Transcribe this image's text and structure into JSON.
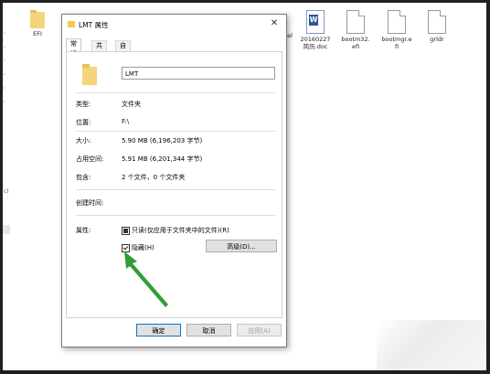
{
  "desktop": {
    "left_strip": [
      "’",
      "’",
      "’",
      "’",
      "’",
      "’",
      "c)"
    ],
    "icons": [
      {
        "label": "EFI",
        "type": "folder"
      },
      {
        "label": "bel",
        "type": "partial"
      },
      {
        "label": "20160227\n简历.doc",
        "type": "word"
      },
      {
        "label": "bootm32.\nefi",
        "type": "file"
      },
      {
        "label": "bootmgr.e\nfi",
        "type": "file"
      },
      {
        "label": "grldr",
        "type": "file"
      }
    ]
  },
  "dialog": {
    "title": "LMT 属性",
    "close_glyph": "✕",
    "tabs": [
      "常规",
      "共享",
      "自定义"
    ],
    "name_value": "LMT",
    "rows": {
      "type_label": "类型:",
      "type_value": "文件夹",
      "location_label": "位置:",
      "location_value": "F:\\",
      "size_label": "大小:",
      "size_value": "5.90 MB (6,196,203 字节)",
      "disk_label": "占用空间:",
      "disk_value": "5.91 MB (6,201,344 字节)",
      "contains_label": "包含:",
      "contains_value": "2 个文件，0 个文件夹",
      "created_label": "创建时间:",
      "created_value": "",
      "attr_label": "属性:"
    },
    "attributes": {
      "readonly_label": "只读(仅应用于文件夹中的文件)(R)",
      "readonly_state": "indeterminate",
      "hidden_label": "隐藏(H)",
      "hidden_state": "checked",
      "advanced_button": "高级(D)..."
    },
    "buttons": {
      "ok": "确定",
      "cancel": "取消",
      "apply": "应用(A)"
    }
  },
  "colors": {
    "arrow": "#2e9e3a",
    "accent_border": "#0078d7",
    "folder": "#f5d57a"
  }
}
